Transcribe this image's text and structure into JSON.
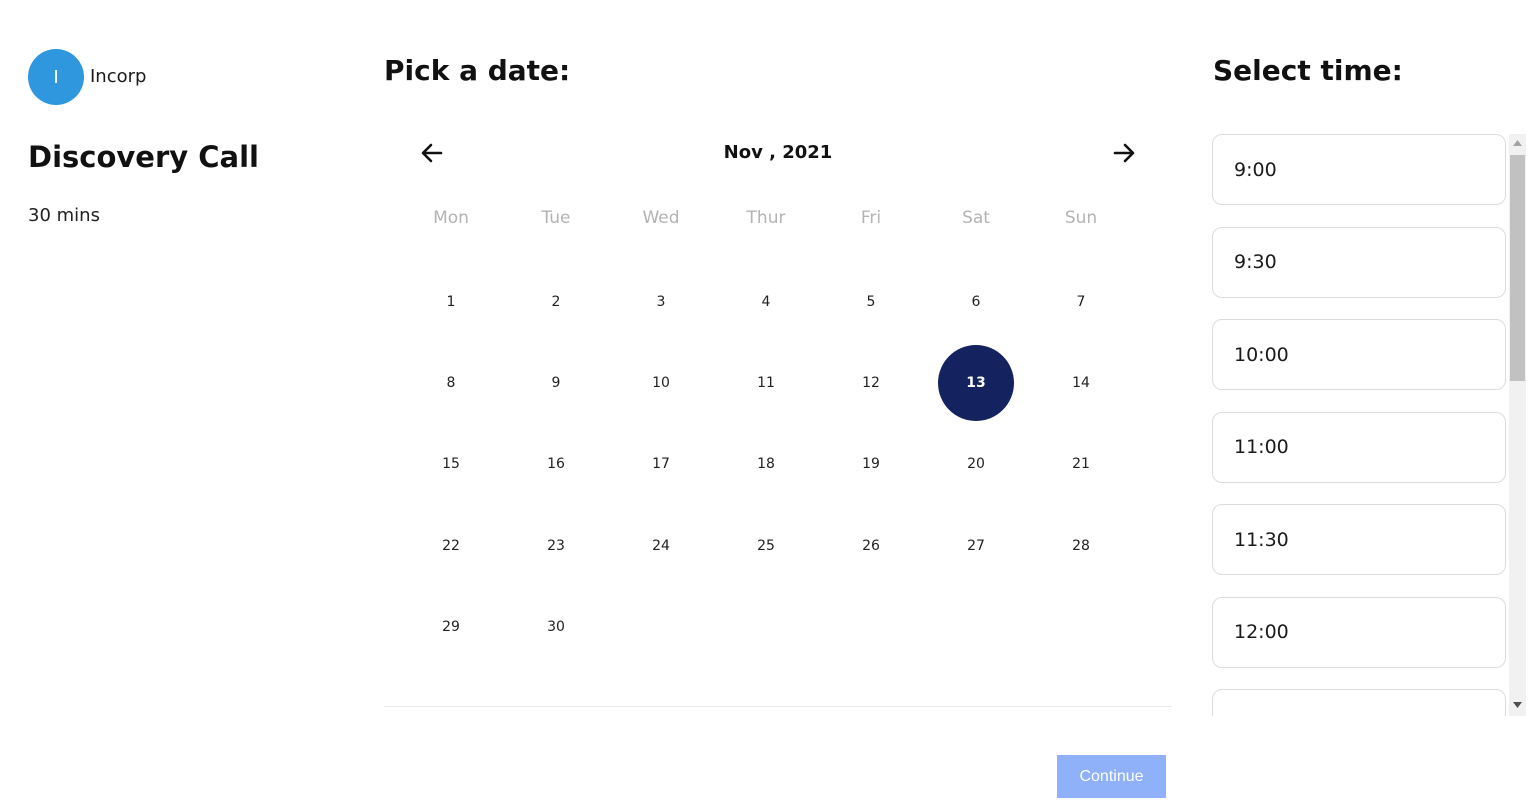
{
  "organization": {
    "avatar_initial": "I",
    "name": "Incorp",
    "avatar_color": "#2f97dd"
  },
  "event": {
    "title": "Discovery Call",
    "duration": "30 mins"
  },
  "date_picker": {
    "title": "Pick a date:",
    "month_label": "Nov , 2021",
    "weekdays": [
      "Mon",
      "Tue",
      "Wed",
      "Thur",
      "Fri",
      "Sat",
      "Sun"
    ],
    "weeks": [
      [
        "1",
        "2",
        "3",
        "4",
        "5",
        "6",
        "7"
      ],
      [
        "8",
        "9",
        "10",
        "11",
        "12",
        "13",
        "14"
      ],
      [
        "15",
        "16",
        "17",
        "18",
        "19",
        "20",
        "21"
      ],
      [
        "22",
        "23",
        "24",
        "25",
        "26",
        "27",
        "28"
      ],
      [
        "29",
        "30",
        "",
        "",
        "",
        "",
        ""
      ]
    ],
    "selected_day": "13",
    "selected_color": "#14235f"
  },
  "time_picker": {
    "title": "Select time:",
    "slots": [
      "9:00",
      "9:30",
      "10:00",
      "11:00",
      "11:30",
      "12:00",
      ""
    ]
  },
  "actions": {
    "continue_label": "Continue",
    "continue_color": "#8eb1f9"
  }
}
